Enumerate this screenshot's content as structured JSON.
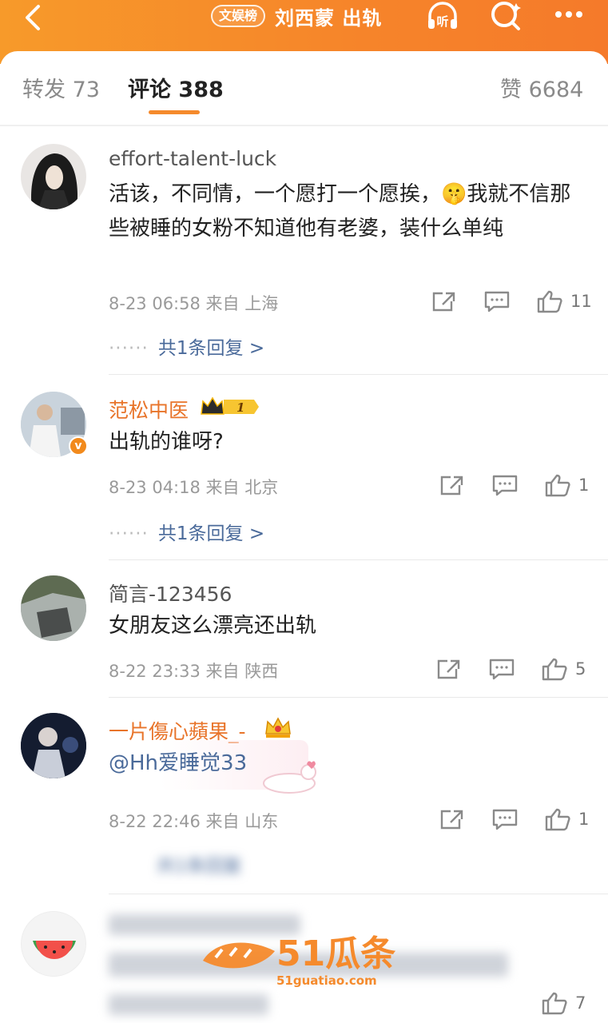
{
  "header": {
    "badge": "文娱榜",
    "title": "刘西蒙 出轨",
    "listen_label": "听"
  },
  "tabs": {
    "repost": {
      "label": "转发",
      "count": "73"
    },
    "comment": {
      "label": "评论",
      "count": "388"
    },
    "like": {
      "label": "赞",
      "count": "6684"
    }
  },
  "comments": [
    {
      "username": "effort-talent-luck",
      "text": "活该，不同情，一个愿打一个愿挨，🤫我就不信那些被睡的女粉不知道他有老婆，装什么单纯",
      "meta": "8-23 06:58 来自 上海",
      "likes": "11",
      "replies": "共1条回复 >"
    },
    {
      "username": "范松中医",
      "fan_level": "1",
      "text": "出轨的谁呀?",
      "meta": "8-23 04:18 来自 北京",
      "likes": "1",
      "replies": "共1条回复 >"
    },
    {
      "username": "简言-123456",
      "text": "女朋友这么漂亮还出轨",
      "meta": "8-22 23:33 来自 陕西",
      "likes": "5"
    },
    {
      "username": "一片傷心蘋果_-",
      "text": "@Hh爱睡觉33",
      "meta": "8-22 22:46 来自 山东",
      "likes": "1",
      "replies": "共1条回复"
    },
    {
      "likes": "7"
    }
  ],
  "watermark": {
    "brand": "51瓜条",
    "url": "51guatiao.com"
  },
  "colors": {
    "header": "#f6842a",
    "accent": "#f58a2c",
    "link": "#4a6a9a",
    "vip_name": "#e8742a"
  }
}
